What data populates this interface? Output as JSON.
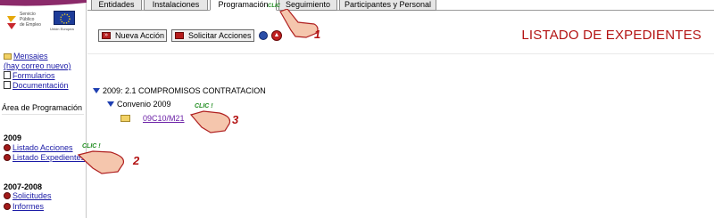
{
  "tabs": [
    {
      "label": "Entidades",
      "active": false
    },
    {
      "label": "Instalaciones",
      "active": false
    },
    {
      "label": "Programación",
      "active": true
    },
    {
      "label": "Seguimiento",
      "active": false
    },
    {
      "label": "Participantes y Personal",
      "active": false
    }
  ],
  "logo": {
    "org_line1": "Servicio",
    "org_line2": "Público",
    "org_line3": "de Empleo",
    "eu_text": "Unión Europea"
  },
  "sidebar": {
    "mensajes": "Mensajes",
    "correo": "(hay correo nuevo)",
    "formularios": "Formularios",
    "documentacion": "Documentación",
    "area_label": "Área de Programación",
    "year1": "2009",
    "listado_acciones": "Listado Acciones",
    "listado_expedientes": "Listado Expedientes",
    "year2": "2007-2008",
    "solicitudes": "Solicitudes",
    "informes": "Informes"
  },
  "toolbar": {
    "nueva_accion": "Nueva Acción",
    "solicitar_acciones": "Solicitar Acciones"
  },
  "page_title": "LISTADO DE EXPEDIENTES",
  "tree": {
    "group": "2009: 2.1 COMPROMISOS CONTRATACION",
    "sub": "Convenio 2009",
    "item": "09C10/M21"
  },
  "annotations": {
    "clic": "CLIC !",
    "clic_tab": "CLIC",
    "n1": "1",
    "n2": "2",
    "n3": "3"
  },
  "colors": {
    "title_red": "#b31212",
    "link_blue": "#1a1aa6",
    "visited_purple": "#6a1fa6",
    "tree_triangle": "#1e3fb1"
  }
}
